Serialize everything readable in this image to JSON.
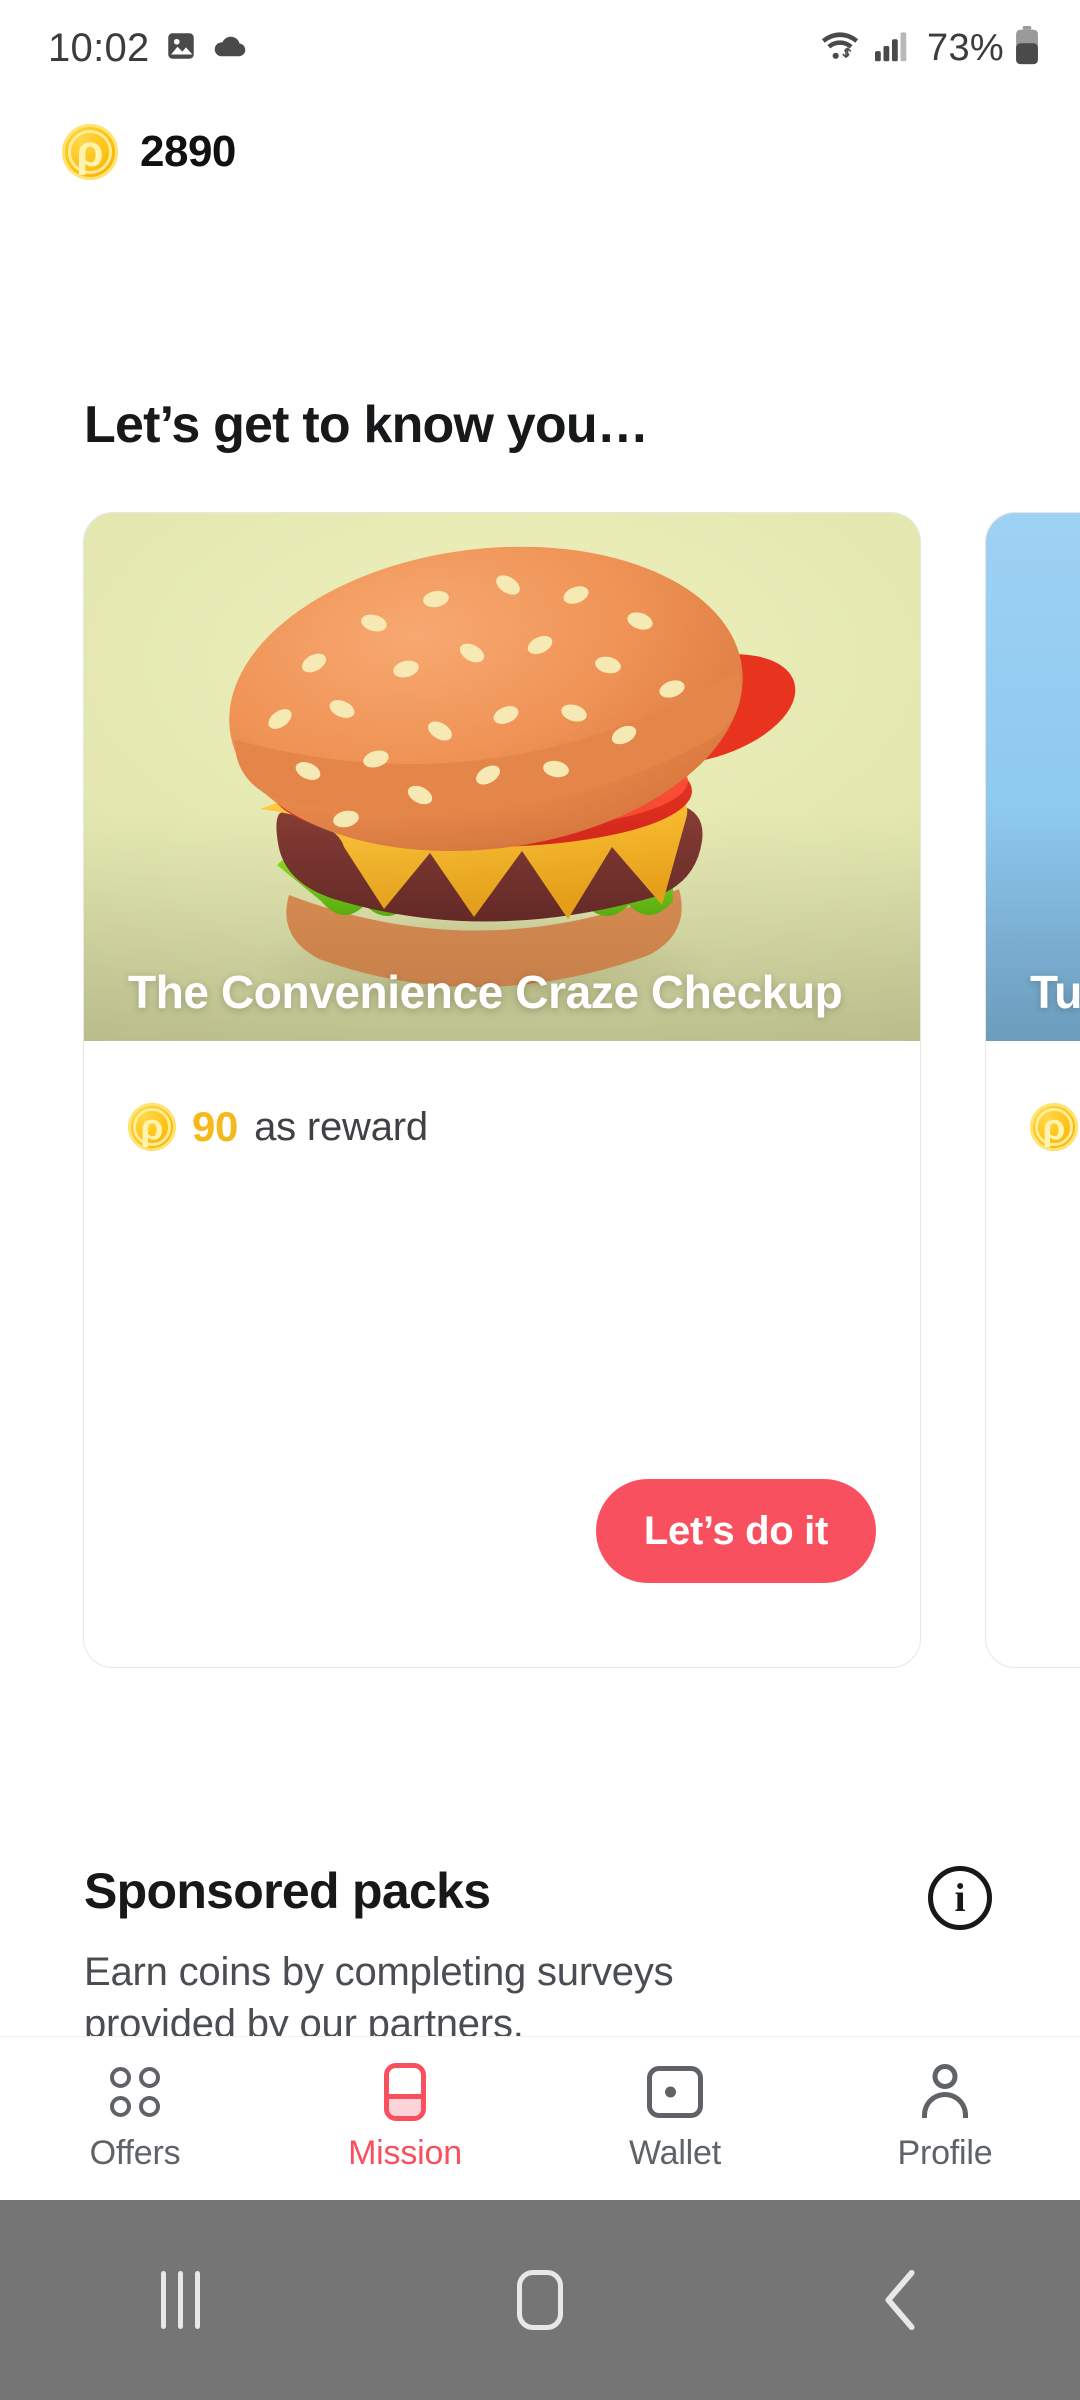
{
  "status_bar": {
    "time": "10:02",
    "battery_percent": "73%",
    "icons": [
      "image-icon",
      "cloud-icon",
      "wifi-icon",
      "signal-icon",
      "battery-icon"
    ]
  },
  "header": {
    "coin_icon": "coin-icon",
    "coin_balance": "2890"
  },
  "section": {
    "title": "Let’s get to know you…"
  },
  "cards": [
    {
      "title": "The Convenience Craze Checkup",
      "reward_amount": "90",
      "reward_label": "as reward",
      "cta_label": "Let’s do it",
      "media": "burger-illustration",
      "media_bg": "#e2e6ae"
    },
    {
      "title": "Tu",
      "reward_amount": "",
      "reward_label": "",
      "cta_label": "",
      "media": "blue-illustration",
      "media_bg": "#8ec9f0"
    }
  ],
  "sponsored": {
    "title": "Sponsored packs",
    "subtitle": "Earn coins by completing surveys provided by our partners.",
    "info_icon": "info-icon",
    "info_glyph": "i"
  },
  "bottom_nav": {
    "items": [
      {
        "label": "Offers",
        "icon": "offers-icon",
        "active": false
      },
      {
        "label": "Mission",
        "icon": "mission-icon",
        "active": true
      },
      {
        "label": "Wallet",
        "icon": "wallet-icon",
        "active": false
      },
      {
        "label": "Profile",
        "icon": "profile-icon",
        "active": false
      }
    ]
  },
  "android_nav": {
    "recent_label": "recent-apps",
    "home_label": "home",
    "back_label": "back"
  },
  "colors": {
    "accent": "#f9505f",
    "coin": "#f5b91b",
    "text_primary": "#17181a",
    "text_secondary": "#4a4d52",
    "nav_inactive": "#5f6368"
  }
}
